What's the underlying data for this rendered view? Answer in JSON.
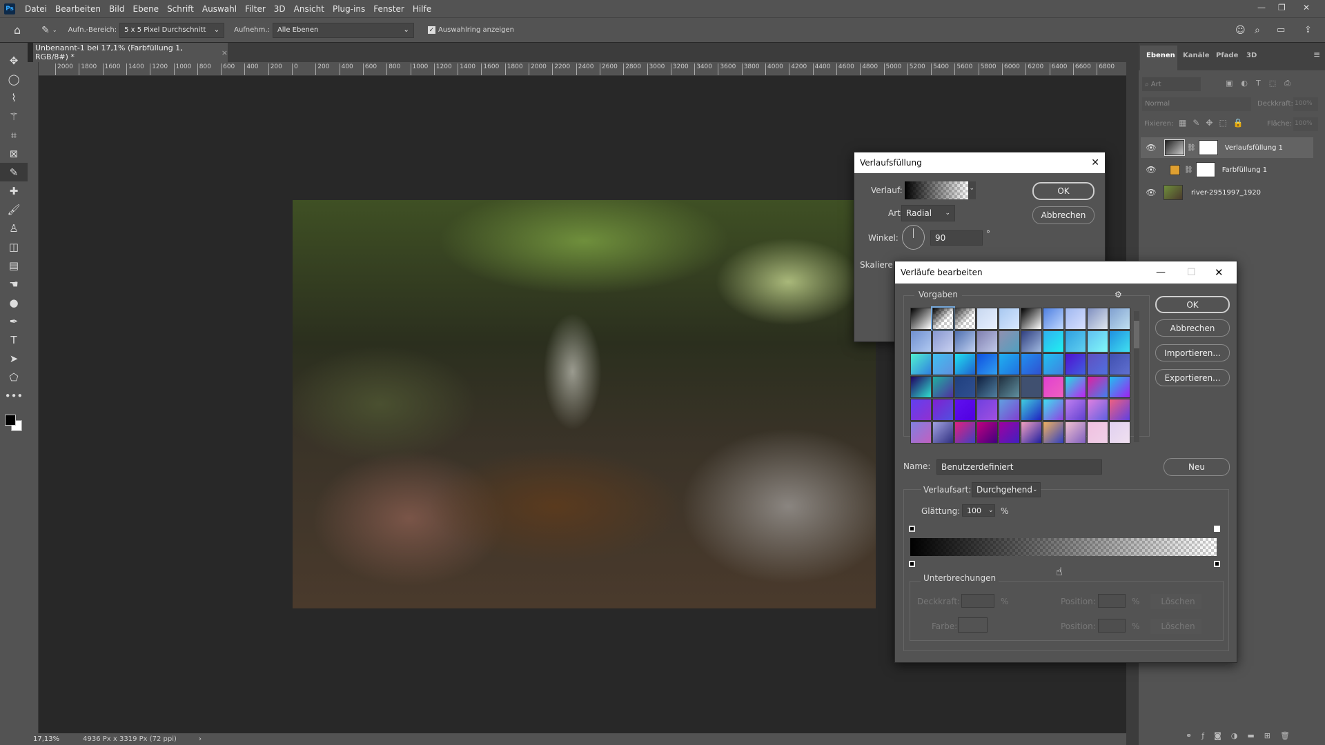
{
  "app": {
    "logo": "Ps"
  },
  "menu": [
    "Datei",
    "Bearbeiten",
    "Bild",
    "Ebene",
    "Schrift",
    "Auswahl",
    "Filter",
    "3D",
    "Ansicht",
    "Plug-ins",
    "Fenster",
    "Hilfe"
  ],
  "options": {
    "sample_size_label": "Aufn.-Bereich:",
    "sample_size_value": "5 x 5 Pixel Durchschnitt",
    "sample_label": "Aufnehm.:",
    "sample_value": "Alle Ebenen",
    "show_ring_label": "Auswahlring anzeigen",
    "show_ring_checked": true
  },
  "document_tab": {
    "title": "Unbenannt-1 bei 17,1% (Farbfüllung 1, RGB/8#) *",
    "close": "×"
  },
  "ruler_labels": [
    "2000",
    "1800",
    "1600",
    "1400",
    "1200",
    "1000",
    "800",
    "600",
    "400",
    "200",
    "0",
    "200",
    "400",
    "600",
    "800",
    "1000",
    "1200",
    "1400",
    "1600",
    "1800",
    "2000",
    "2200",
    "2400",
    "2600",
    "2800",
    "3000",
    "3200",
    "3400",
    "3600",
    "3800",
    "4000",
    "4200",
    "4400",
    "4600",
    "4800",
    "5000",
    "5200",
    "5400",
    "5600",
    "5800",
    "6000",
    "6200",
    "6400",
    "6600",
    "6800"
  ],
  "tools": [
    "move-icon",
    "lasso-icon",
    "polygon-lasso-icon",
    "magic-wand-icon",
    "crop-icon",
    "frame-icon",
    "eyedropper-icon",
    "healing-icon",
    "brush-icon",
    "stamp-icon",
    "eraser-icon",
    "gradient-icon",
    "smudge-icon",
    "dodge-icon",
    "pen-icon",
    "type-icon",
    "path-select-icon",
    "shape-icon",
    "more-icon"
  ],
  "status": {
    "zoom": "17,13%",
    "dimensions": "4936 Px x 3319 Px (72 ppi)",
    "arrow": "›"
  },
  "layers_panel": {
    "tabs": [
      "Ebenen",
      "Kanäle",
      "Pfade",
      "3D"
    ],
    "search_placeholder": "Art",
    "blend_mode": "Normal",
    "opacity_label": "Deckkraft:",
    "opacity_value": "100%",
    "lock_label": "Fixieren:",
    "fill_label": "Fläche:",
    "fill_value": "100%",
    "layers": [
      {
        "name": "Verlaufsfüllung 1",
        "selected": true
      },
      {
        "name": "Farbfüllung 1",
        "selected": false,
        "color": "#e0a030"
      },
      {
        "name": "river-2951997_1920",
        "selected": false
      }
    ]
  },
  "gradient_fill_dialog": {
    "title": "Verlaufsfüllung",
    "gradient_label": "Verlauf:",
    "style_label": "Art:",
    "style_value": "Radial",
    "angle_label": "Winkel:",
    "angle_value": "90",
    "degree": "°",
    "scale_label": "Skaliere",
    "ok": "OK",
    "cancel": "Abbrechen"
  },
  "gradient_editor": {
    "title": "Verläufe bearbeiten",
    "presets_label": "Vorgaben",
    "ok": "OK",
    "cancel": "Abbrechen",
    "import": "Importieren...",
    "export": "Exportieren...",
    "name_label": "Name:",
    "name_value": "Benutzerdefiniert",
    "new": "Neu",
    "type_label": "Verlaufsart:",
    "type_value": "Durchgehend",
    "smoothness_label": "Glättung:",
    "smoothness_value": "100",
    "percent": "%",
    "stops_label": "Unterbrechungen",
    "opacity_label": "Deckkraft:",
    "color_label": "Farbe:",
    "position_label": "Position:",
    "delete": "Löschen",
    "swatches": [
      [
        "#000",
        "#fff"
      ],
      [
        "#000",
        "checker"
      ],
      [
        "#333",
        "checker"
      ],
      [
        "#c8d8f0",
        "#e8f0ff"
      ],
      [
        "#a8c8f0",
        "#d8e8ff"
      ],
      [
        "#000",
        "#fff"
      ],
      [
        "#5080e0",
        "#c0d8ff"
      ],
      [
        "#a0b8f0",
        "#d8e0ff"
      ],
      [
        "#8090c0",
        "#e0e8f0"
      ],
      [
        "#80a0d0",
        "#c0e0f0"
      ],
      [
        "#7090d0",
        "#b0c8f0"
      ],
      [
        "#8898d0",
        "#c8d0f0"
      ],
      [
        "#5070b0",
        "#c0d0f0"
      ],
      [
        "#8080b0",
        "#c0c8e8"
      ],
      [
        "#9090b0",
        "#50a0c0"
      ],
      [
        "#304080",
        "#a0b8e0"
      ],
      [
        "#30b0f0",
        "#20f0f0"
      ],
      [
        "#30a0e0",
        "#60d0f0"
      ],
      [
        "#60c0f0",
        "#80f8f8"
      ],
      [
        "#2090e0",
        "#40e0f0"
      ],
      [
        "#50f0d0",
        "#3080e0"
      ],
      [
        "#40c0f0",
        "#6090e0"
      ],
      [
        "#20e0f0",
        "#2060d0"
      ],
      [
        "#1050e0",
        "#30a0f0"
      ],
      [
        "#20b0f0",
        "#2070e0"
      ],
      [
        "#2090f0",
        "#3050d0"
      ],
      [
        "#20c0f0",
        "#4080e0"
      ],
      [
        "#5010d0",
        "#4060e0"
      ],
      [
        "#6050c0",
        "#5070e0"
      ],
      [
        "#4050b0",
        "#6070d0"
      ],
      [
        "#200060",
        "#30e0d0"
      ],
      [
        "#20b0a0",
        "#5030a0"
      ],
      [
        "#204080",
        "#305090"
      ],
      [
        "#102040",
        "#5080a0"
      ],
      [
        "#203040",
        "#6090a0"
      ],
      [
        "#405070",
        "#405070"
      ],
      [
        "#e040d0",
        "#f060c0"
      ],
      [
        "#20e0e0",
        "#c020f0"
      ],
      [
        "#e020a0",
        "#4080f0"
      ],
      [
        "#20c0f0",
        "#a020f0"
      ],
      [
        "#6040f0",
        "#9030d0"
      ],
      [
        "#8020d0",
        "#5050e0"
      ],
      [
        "#6010f0",
        "#5000e0"
      ],
      [
        "#7040e0",
        "#a050e0"
      ],
      [
        "#60a0e0",
        "#8040d0"
      ],
      [
        "#40d0e0",
        "#2020c0"
      ],
      [
        "#40e0f0",
        "#9040e0"
      ],
      [
        "#c080f0",
        "#6040d0"
      ],
      [
        "#e080e0",
        "#6060e0"
      ],
      [
        "#f06080",
        "#6040e0"
      ],
      [
        "#8080e0",
        "#c060c0"
      ],
      [
        "#a0a0e0",
        "#303080"
      ],
      [
        "#e02080",
        "#4040c0"
      ],
      [
        "#c00080",
        "#400080"
      ],
      [
        "#a000a0",
        "#4020c0"
      ],
      [
        "#f0a0c0",
        "#2020a0"
      ],
      [
        "#f0b060",
        "#3040c0"
      ],
      [
        "#f0c0d0",
        "#8060c0"
      ],
      [
        "#f0c0e0",
        "#f0d0e8"
      ],
      [
        "#e0d0f0",
        "#f0e0f0"
      ]
    ]
  }
}
